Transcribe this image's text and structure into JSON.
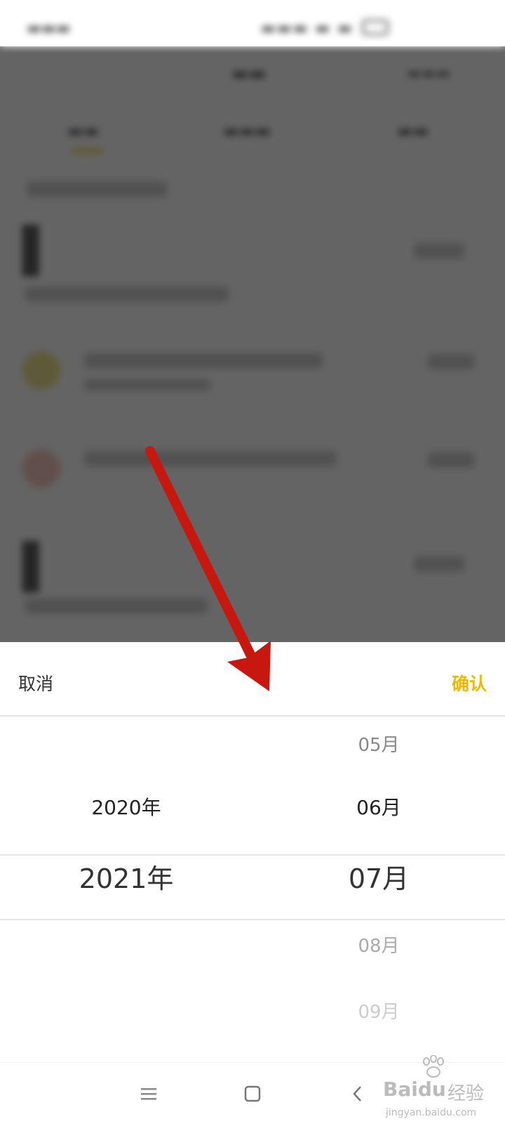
{
  "colors": {
    "accent": "#f0b800",
    "arrow": "#c8170f",
    "text_primary": "#222222",
    "text_secondary": "#999999",
    "divider": "#e6e6e6"
  },
  "sheet": {
    "cancel_label": "取消",
    "confirm_label": "确认"
  },
  "picker": {
    "years": [
      {
        "label": "2020年",
        "state": "adjacent"
      },
      {
        "label": "2021年",
        "state": "selected"
      }
    ],
    "months": [
      {
        "label": "05月",
        "state": "faded"
      },
      {
        "label": "06月",
        "state": "adjacent"
      },
      {
        "label": "07月",
        "state": "selected"
      },
      {
        "label": "08月",
        "state": "faded"
      },
      {
        "label": "09月",
        "state": "faded-more"
      }
    ]
  },
  "nav": {
    "icons": [
      "menu-icon",
      "home-icon",
      "back-icon"
    ]
  },
  "watermark": {
    "brand": "Baidu",
    "brand_cn": "经验",
    "url": "jingyan.baidu.com"
  }
}
